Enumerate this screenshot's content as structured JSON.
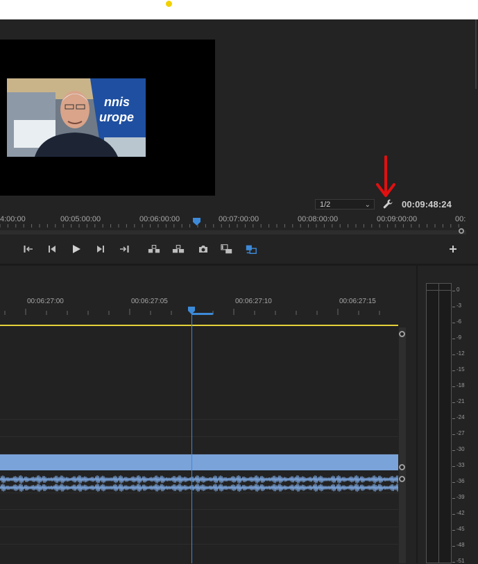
{
  "monitor": {
    "resolution": "1/2",
    "timecode": "00:09:48:24",
    "ruler": [
      {
        "label": "4:00:00"
      },
      {
        "label": "00:05:00:00"
      },
      {
        "label": "00:06:00:00"
      },
      {
        "label": "00:07:00:00"
      },
      {
        "label": "00:08:00:00"
      },
      {
        "label": "00:09:00:00"
      },
      {
        "label": "00:"
      }
    ]
  },
  "transport": {
    "buttons": [
      {
        "name": "mark-in-button",
        "icon": "mark-in-icon"
      },
      {
        "name": "step-back-button",
        "icon": "step-back-icon"
      },
      {
        "name": "play-button",
        "icon": "play-icon"
      },
      {
        "name": "step-forward-button",
        "icon": "step-forward-icon"
      },
      {
        "name": "mark-out-button",
        "icon": "mark-out-icon"
      },
      {
        "name": "lift-button",
        "icon": "lift-icon"
      },
      {
        "name": "extract-button",
        "icon": "extract-icon"
      },
      {
        "name": "export-frame-button",
        "icon": "camera-icon"
      },
      {
        "name": "insert-button",
        "icon": "insert-icon"
      },
      {
        "name": "overwrite-button",
        "icon": "overwrite-icon"
      },
      {
        "name": "add-button",
        "icon": "plus-icon"
      }
    ]
  },
  "sequence": {
    "ruler": [
      {
        "label": "00:06:27:00"
      },
      {
        "label": "00:06:27:05"
      },
      {
        "label": "00:06:27:10"
      },
      {
        "label": "00:06:27:15"
      }
    ]
  },
  "meter": {
    "db_scale": [
      "0",
      "-3",
      "-6",
      "-9",
      "-12",
      "-15",
      "-18",
      "-21",
      "-24",
      "-27",
      "-30",
      "-33",
      "-36",
      "-39",
      "-42",
      "-45",
      "-48",
      "-51"
    ]
  },
  "colors": {
    "accent": "#3d8ad9",
    "work_area": "#e6d23a",
    "audio_clip": "#7aa3d9",
    "annotation_arrow": "#e01010"
  }
}
